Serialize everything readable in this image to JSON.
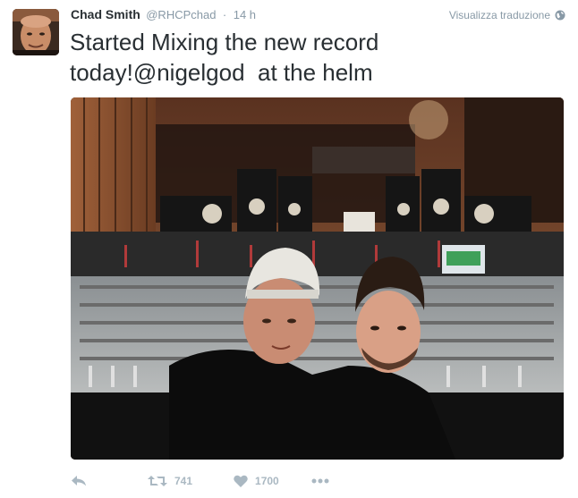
{
  "tweet": {
    "fullname": "Chad Smith",
    "username": "@RHCPchad",
    "separator": "·",
    "time": "14 h",
    "translate_label": "Visualizza traduzione",
    "text": "Started Mixing the new record today!@nigelgod  at the helm"
  },
  "actions": {
    "retweet_count": "741",
    "like_count": "1700"
  },
  "icons": [
    "reply-icon",
    "retweet-icon",
    "heart-icon",
    "more-icon",
    "globe-icon"
  ],
  "colors": {
    "name": "#292f33",
    "meta": "#8899a6",
    "action": "#aab8c2"
  }
}
